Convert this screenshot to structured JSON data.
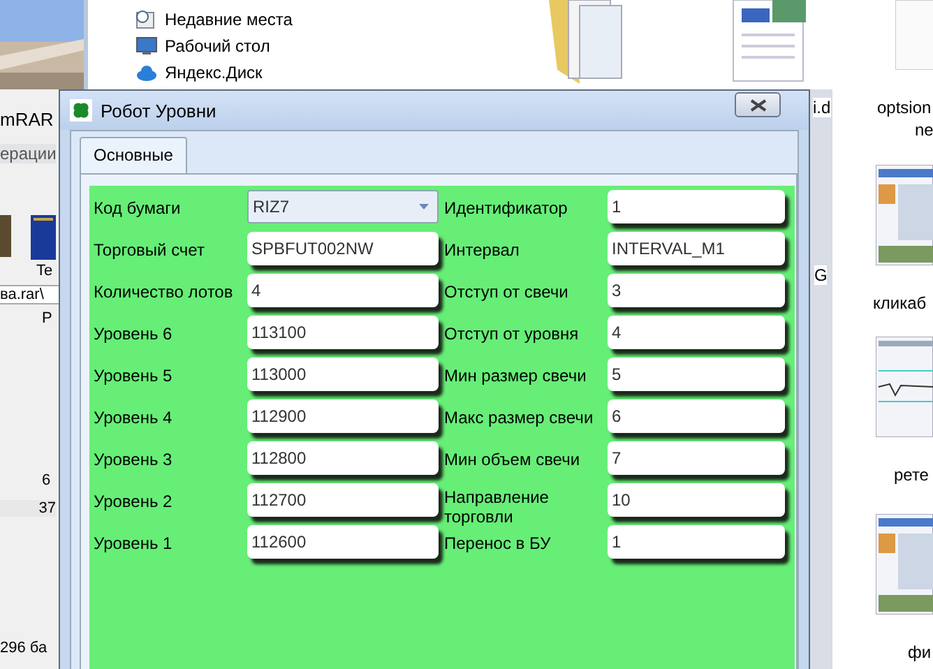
{
  "background": {
    "explorer_nav": [
      {
        "label": "Недавние места",
        "kind": "recent"
      },
      {
        "label": "Рабочий стол",
        "kind": "desktop"
      },
      {
        "label": "Яндекс.Диск",
        "kind": "cloud"
      }
    ],
    "file_labels": [
      {
        "text": "i.d",
        "kind": "doc"
      },
      {
        "text": "optsion",
        "kind": "blank"
      },
      {
        "text": "ne",
        "kind": "none"
      },
      {
        "text": "G",
        "kind": "none"
      },
      {
        "text": "кликаб",
        "kind": "shot"
      },
      {
        "text": "рете",
        "kind": "chart"
      },
      {
        "text": "фи",
        "kind": "shot"
      }
    ],
    "winrar": {
      "title": "mRAR",
      "menu": "ерации",
      "tool": "Te",
      "path": "ва.rar\\",
      "column": "Р",
      "cells": [
        "6",
        "37"
      ],
      "status": "296 ба"
    }
  },
  "window": {
    "title": "Робот Уровни"
  },
  "tabs": [
    {
      "label": "Основные",
      "selected": true
    }
  ],
  "left_fields": [
    {
      "label": "Код бумаги",
      "value": "RIZ7",
      "kind": "dropdown"
    },
    {
      "label": "Торговый счет",
      "value": "SPBFUT002NW",
      "kind": "text"
    },
    {
      "label": "Количество лотов",
      "value": "4",
      "kind": "text"
    },
    {
      "label": "Уровень 6",
      "value": "113100",
      "kind": "text"
    },
    {
      "label": "Уровень 5",
      "value": "113000",
      "kind": "text"
    },
    {
      "label": "Уровень 4",
      "value": "112900",
      "kind": "text"
    },
    {
      "label": "Уровень 3",
      "value": "112800",
      "kind": "text"
    },
    {
      "label": "Уровень 2",
      "value": "112700",
      "kind": "text"
    },
    {
      "label": "Уровень 1",
      "value": "112600",
      "kind": "text"
    }
  ],
  "right_fields": [
    {
      "label": "Идентификатор",
      "value": "1",
      "kind": "text"
    },
    {
      "label": "Интервал",
      "value": "INTERVAL_M1",
      "kind": "text"
    },
    {
      "label": "Отступ от свечи",
      "value": "3",
      "kind": "text"
    },
    {
      "label": "Отступ от уровня",
      "value": "4",
      "kind": "text"
    },
    {
      "label": "Мин размер свечи",
      "value": "5",
      "kind": "text"
    },
    {
      "label": "Макс размер свечи",
      "value": "6",
      "kind": "text"
    },
    {
      "label": "Мин объем свечи",
      "value": "7",
      "kind": "text"
    },
    {
      "label": "Направление торговли",
      "value": "10",
      "kind": "text"
    },
    {
      "label": "Перенос в БУ",
      "value": "1",
      "kind": "text"
    }
  ]
}
